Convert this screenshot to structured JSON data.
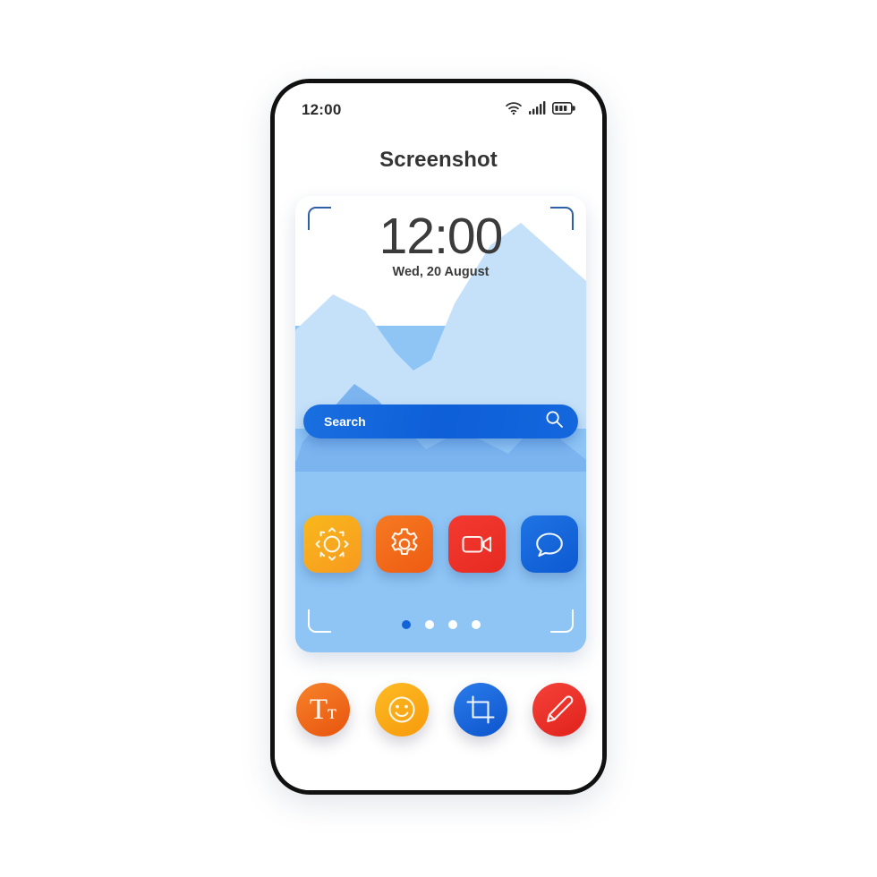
{
  "status_bar": {
    "time": "12:00",
    "icons": [
      "wifi-icon",
      "cellular-signal-icon",
      "battery-icon"
    ]
  },
  "header": {
    "title": "Screenshot"
  },
  "preview": {
    "clock_time": "12:00",
    "clock_date": "Wed, 20 August",
    "search": {
      "placeholder": "Search",
      "icon": "search-icon"
    },
    "app_icons": [
      {
        "name": "weather-app-icon",
        "glyph": "sun-icon",
        "color": "#f9b016",
        "color2": "#f7a021"
      },
      {
        "name": "settings-app-icon",
        "glyph": "gear-icon",
        "color": "#f4701f",
        "color2": "#ee5f16"
      },
      {
        "name": "video-app-icon",
        "glyph": "video-camera-icon",
        "color": "#f0342c",
        "color2": "#e82a23"
      },
      {
        "name": "chat-app-icon",
        "glyph": "chat-bubble-icon",
        "color": "#1a6fe0",
        "color2": "#0f5ed6"
      }
    ],
    "page_dots": {
      "count": 4,
      "active_index": 0
    },
    "crop_brackets": {
      "top_color": "#2d5fa8",
      "bottom_color": "#ffffff"
    }
  },
  "toolbar": {
    "buttons": [
      {
        "name": "text-tool-button",
        "label": "Tт",
        "icon": "text-icon",
        "color": "#f4701f",
        "color2": "#ea5a12"
      },
      {
        "name": "emoji-tool-button",
        "label": "",
        "icon": "smiley-icon",
        "color": "#fbb018",
        "color2": "#f79d10"
      },
      {
        "name": "crop-tool-button",
        "label": "",
        "icon": "crop-icon",
        "color": "#1a6fe0",
        "color2": "#0f5ad2"
      },
      {
        "name": "draw-tool-button",
        "label": "",
        "icon": "pencil-icon",
        "color": "#f0352c",
        "color2": "#e32720"
      }
    ],
    "text_big": "T",
    "text_small": "т"
  },
  "theme": {
    "frame_color": "#111111",
    "accent_blue": "#1462d8",
    "wallpaper_sky": "#8ec5f5",
    "mountain_light": "#c5e1f9",
    "mountain_mid": "#7bb4ef"
  }
}
